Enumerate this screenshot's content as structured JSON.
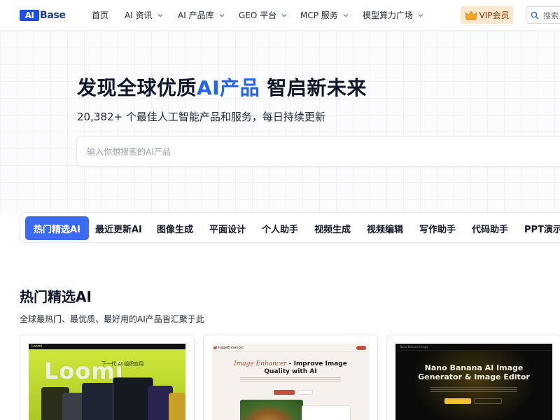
{
  "header": {
    "logo_mark": "AI",
    "logo_text": "Base",
    "nav": [
      {
        "label": "首页",
        "has_dropdown": false
      },
      {
        "label": "AI 资讯",
        "has_dropdown": true
      },
      {
        "label": "AI 产品库",
        "has_dropdown": true
      },
      {
        "label": "GEO 平台",
        "has_dropdown": true
      },
      {
        "label": "MCP 服务",
        "has_dropdown": true
      },
      {
        "label": "模型算力广场",
        "has_dropdown": true
      }
    ],
    "vip_label": "VIP会员",
    "search_placeholder": "搜索"
  },
  "hero": {
    "title_before": "发现全球优质",
    "title_accent": "AI产品",
    "title_after": " 智启新未来",
    "subtitle": "20,382+ 个最佳人工智能产品和服务，每日持续更新",
    "search_placeholder": "输入你想搜索的AI产品",
    "search_value": ""
  },
  "tabs": {
    "items": [
      "热门精选AI",
      "最近更新AI",
      "图像生成",
      "平面设计",
      "个人助手",
      "视频生成",
      "视频编辑",
      "写作助手",
      "代码助手",
      "PPT演示处"
    ],
    "active_index": 0
  },
  "section": {
    "title": "热门精选AI",
    "description": "全球最热门、最优质、最好用的AI产品皆汇聚于此"
  },
  "cards": [
    {
      "name": "Loomi",
      "thumb_title": "Loomi",
      "thumb_tagline": "下一代 AI 组织应用"
    },
    {
      "name": "Image Enhancer",
      "thumb_brand": "ImageEnhancer",
      "thumb_title_em": "Image Enhancer",
      "thumb_title_rest": " - Improve Image Quality with AI"
    },
    {
      "name": "Nano Banana",
      "thumb_brand": "Nano Banana Image",
      "thumb_title": "Nano Banana AI Image Generator & Image Editor"
    }
  ],
  "colors": {
    "brand": "#1f4fe0",
    "accent": "#2563eb",
    "active_tab": "#3b6cf0",
    "vip_bg": "#fde7cf"
  }
}
